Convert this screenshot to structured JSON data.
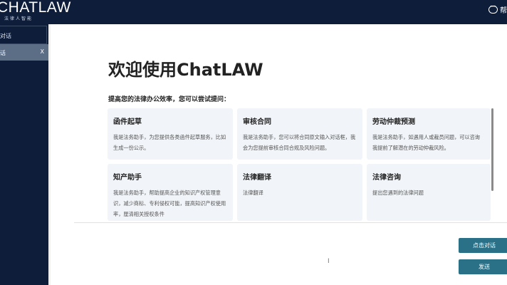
{
  "header": {
    "logo_main": "CHATLAW",
    "logo_sub": "法律人智能",
    "help_label": "帮"
  },
  "sidebar": {
    "new_chat": "对话",
    "chat_item": "话",
    "close": "X"
  },
  "main": {
    "title": "欢迎使用ChatLAW",
    "subtitle": "提高您的法律办公效率，您可以尝试提问：",
    "cards": [
      {
        "title": "函件起草",
        "desc": "我是法务助手，为您提供各类函件起草服务，比如生成一份公示。"
      },
      {
        "title": "审核合同",
        "desc": "我是法务助手，您可以将合同原文输入对话框，我会为您提前审核合同合规及风险问题。"
      },
      {
        "title": "劳动仲裁预测",
        "desc": "我是法务助手，如遇用人或裁员问题，可以咨询我提前了解潜在的劳动仲裁风险。"
      },
      {
        "title": "知产助手",
        "desc": "我是法务助手，帮助提高企业的知识产权管理意识，减少商标、专利侵权可能，提高知识产权使用率，厘清相关授权条件"
      },
      {
        "title": "法律翻译",
        "desc": "法律翻译"
      },
      {
        "title": "法律咨询",
        "desc": "提出您遇到的法律问题"
      }
    ],
    "btn_new_chat": "点击对话",
    "btn_send": "发送",
    "cursor": "I"
  }
}
